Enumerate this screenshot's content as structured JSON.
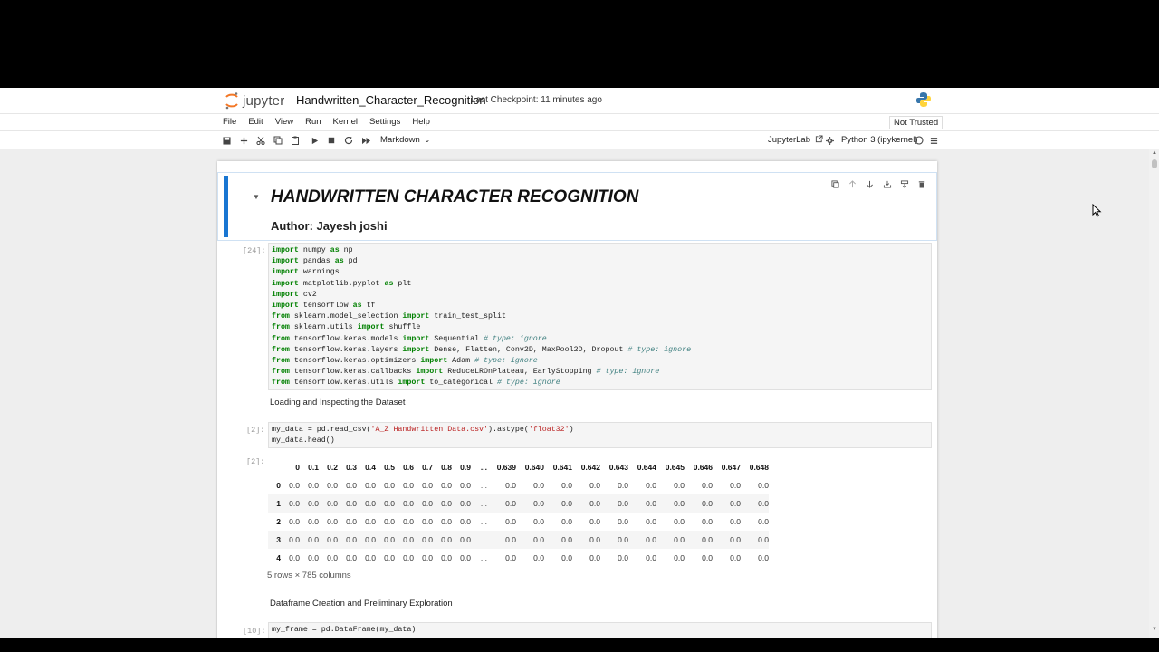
{
  "app": {
    "logo_text": "jupyter",
    "notebook_title": "Handwritten_Character_Recognition",
    "checkpoint": "Last Checkpoint: 11 minutes ago",
    "trusted": "Not Trusted"
  },
  "menu": [
    "File",
    "Edit",
    "View",
    "Run",
    "Kernel",
    "Settings",
    "Help"
  ],
  "toolbar": {
    "cell_type": "Markdown",
    "jupyterlab": "JupyterLab",
    "kernel": "Python 3 (ipykernel)"
  },
  "cells": {
    "heading": {
      "title": "HANDWRITTEN CHARACTER RECOGNITION",
      "author": "Author: Jayesh joshi"
    },
    "imports": {
      "prompt": "[24]:",
      "lines": [
        [
          [
            "kw",
            "import"
          ],
          [
            "",
            " numpy "
          ],
          [
            "kw",
            "as"
          ],
          [
            "",
            " np"
          ]
        ],
        [
          [
            "kw",
            "import"
          ],
          [
            "",
            " pandas "
          ],
          [
            "kw",
            "as"
          ],
          [
            "",
            " pd"
          ]
        ],
        [
          [
            "kw",
            "import"
          ],
          [
            "",
            " warnings"
          ]
        ],
        [
          [
            "kw",
            "import"
          ],
          [
            "",
            " matplotlib.pyplot "
          ],
          [
            "kw",
            "as"
          ],
          [
            "",
            " plt"
          ]
        ],
        [
          [
            "kw",
            "import"
          ],
          [
            "",
            " cv2"
          ]
        ],
        [
          [
            "kw",
            "import"
          ],
          [
            "",
            " tensorflow "
          ],
          [
            "kw",
            "as"
          ],
          [
            "",
            " tf"
          ]
        ],
        [
          [
            "kw",
            "from"
          ],
          [
            "",
            " sklearn.model_selection "
          ],
          [
            "kw",
            "import"
          ],
          [
            "",
            " train_test_split"
          ]
        ],
        [
          [
            "kw",
            "from"
          ],
          [
            "",
            " sklearn.utils "
          ],
          [
            "kw",
            "import"
          ],
          [
            "",
            " shuffle"
          ]
        ],
        [
          [
            "kw",
            "from"
          ],
          [
            "",
            " tensorflow.keras.models "
          ],
          [
            "kw",
            "import"
          ],
          [
            "",
            " Sequential "
          ],
          [
            "cm",
            "# type: ignore"
          ]
        ],
        [
          [
            "kw",
            "from"
          ],
          [
            "",
            " tensorflow.keras.layers "
          ],
          [
            "kw",
            "import"
          ],
          [
            "",
            " Dense, Flatten, Conv2D, MaxPool2D, Dropout "
          ],
          [
            "cm",
            "# type: ignore"
          ]
        ],
        [
          [
            "kw",
            "from"
          ],
          [
            "",
            " tensorflow.keras.optimizers "
          ],
          [
            "kw",
            "import"
          ],
          [
            "",
            " Adam "
          ],
          [
            "cm",
            "# type: ignore"
          ]
        ],
        [
          [
            "kw",
            "from"
          ],
          [
            "",
            " tensorflow.keras.callbacks "
          ],
          [
            "kw",
            "import"
          ],
          [
            "",
            " ReduceLROnPlateau, EarlyStopping "
          ],
          [
            "cm",
            "# type: ignore"
          ]
        ],
        [
          [
            "kw",
            "from"
          ],
          [
            "",
            " tensorflow.keras.utils "
          ],
          [
            "kw",
            "import"
          ],
          [
            "",
            " to_categorical "
          ],
          [
            "cm",
            "# type: ignore"
          ]
        ]
      ]
    },
    "md_loading": "Loading and Inspecting the Dataset",
    "read_csv": {
      "prompt": "[2]:",
      "lines": [
        [
          [
            "",
            "my_data = pd.read_csv("
          ],
          [
            "st",
            "'A_Z Handwritten Data.csv'"
          ],
          [
            "",
            ").astype("
          ],
          [
            "st",
            "'float32'"
          ],
          [
            "",
            ")"
          ]
        ],
        [
          [
            "",
            "my_data.head()"
          ]
        ]
      ]
    },
    "output": {
      "prompt": "[2]:",
      "columns": [
        "",
        "0",
        "0.1",
        "0.2",
        "0.3",
        "0.4",
        "0.5",
        "0.6",
        "0.7",
        "0.8",
        "0.9",
        "...",
        "0.639",
        "0.640",
        "0.641",
        "0.642",
        "0.643",
        "0.644",
        "0.645",
        "0.646",
        "0.647",
        "0.648"
      ],
      "rows": [
        [
          "0",
          "0.0",
          "0.0",
          "0.0",
          "0.0",
          "0.0",
          "0.0",
          "0.0",
          "0.0",
          "0.0",
          "0.0",
          "...",
          "0.0",
          "0.0",
          "0.0",
          "0.0",
          "0.0",
          "0.0",
          "0.0",
          "0.0",
          "0.0",
          "0.0"
        ],
        [
          "1",
          "0.0",
          "0.0",
          "0.0",
          "0.0",
          "0.0",
          "0.0",
          "0.0",
          "0.0",
          "0.0",
          "0.0",
          "...",
          "0.0",
          "0.0",
          "0.0",
          "0.0",
          "0.0",
          "0.0",
          "0.0",
          "0.0",
          "0.0",
          "0.0"
        ],
        [
          "2",
          "0.0",
          "0.0",
          "0.0",
          "0.0",
          "0.0",
          "0.0",
          "0.0",
          "0.0",
          "0.0",
          "0.0",
          "...",
          "0.0",
          "0.0",
          "0.0",
          "0.0",
          "0.0",
          "0.0",
          "0.0",
          "0.0",
          "0.0",
          "0.0"
        ],
        [
          "3",
          "0.0",
          "0.0",
          "0.0",
          "0.0",
          "0.0",
          "0.0",
          "0.0",
          "0.0",
          "0.0",
          "0.0",
          "...",
          "0.0",
          "0.0",
          "0.0",
          "0.0",
          "0.0",
          "0.0",
          "0.0",
          "0.0",
          "0.0",
          "0.0"
        ],
        [
          "4",
          "0.0",
          "0.0",
          "0.0",
          "0.0",
          "0.0",
          "0.0",
          "0.0",
          "0.0",
          "0.0",
          "0.0",
          "...",
          "0.0",
          "0.0",
          "0.0",
          "0.0",
          "0.0",
          "0.0",
          "0.0",
          "0.0",
          "0.0",
          "0.0"
        ]
      ],
      "shape": "5 rows × 785 columns"
    },
    "md_dataframe": "Dataframe Creation and Preliminary Exploration",
    "frame": {
      "prompt": "[10]:",
      "lines": [
        [
          [
            "",
            "my_frame = pd.DataFrame(my_data)"
          ]
        ]
      ]
    }
  },
  "icons": {
    "toolbar": [
      "save-icon",
      "add-icon",
      "cut-icon",
      "copy-icon",
      "paste-icon",
      "run-icon",
      "stop-icon",
      "restart-icon",
      "fast-forward-icon"
    ],
    "cell": [
      "duplicate-icon",
      "move-up-icon",
      "move-down-icon",
      "insert-below-icon",
      "merge-icon",
      "delete-icon"
    ]
  },
  "colors": {
    "accent": "#1976d2",
    "keyword": "#008000",
    "comment": "#408080",
    "string": "#ba2121"
  }
}
